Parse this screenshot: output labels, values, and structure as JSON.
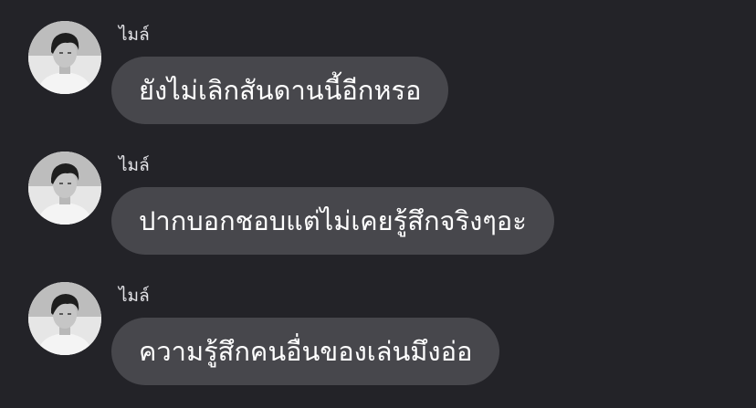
{
  "messages": [
    {
      "sender": "ไมล์",
      "text": "ยังไม่เลิกสันดานนี้อีกหรอ"
    },
    {
      "sender": "ไมล์",
      "text": "ปากบอกชอบแต่ไม่เคยรู้สึกจริงๆอะ"
    },
    {
      "sender": "ไมล์",
      "text": "ความรู้สึกคนอื่นของเล่นมึงอ่อ"
    }
  ],
  "avatar_icon": "profile-photo-grayscale"
}
